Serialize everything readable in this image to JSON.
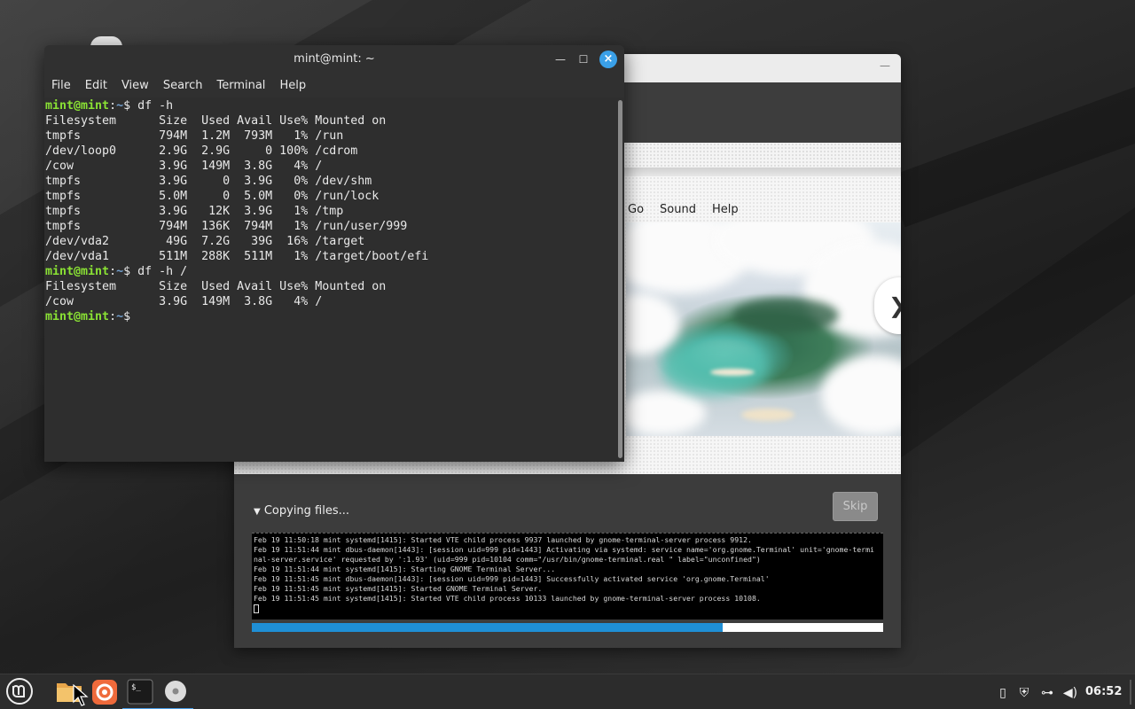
{
  "terminal": {
    "title": "mint@mint: ~",
    "menu": [
      "File",
      "Edit",
      "View",
      "Search",
      "Terminal",
      "Help"
    ],
    "lines": [
      {
        "type": "prompt",
        "user": "mint@mint",
        "path": "~",
        "cmd": "df -h"
      },
      {
        "type": "out",
        "text": "Filesystem      Size  Used Avail Use% Mounted on"
      },
      {
        "type": "out",
        "text": "tmpfs           794M  1.2M  793M   1% /run"
      },
      {
        "type": "out",
        "text": "/dev/loop0      2.9G  2.9G     0 100% /cdrom"
      },
      {
        "type": "out",
        "text": "/cow            3.9G  149M  3.8G   4% /"
      },
      {
        "type": "out",
        "text": "tmpfs           3.9G     0  3.9G   0% /dev/shm"
      },
      {
        "type": "out",
        "text": "tmpfs           5.0M     0  5.0M   0% /run/lock"
      },
      {
        "type": "out",
        "text": "tmpfs           3.9G   12K  3.9G   1% /tmp"
      },
      {
        "type": "out",
        "text": "tmpfs           794M  136K  794M   1% /run/user/999"
      },
      {
        "type": "out",
        "text": "/dev/vda2        49G  7.2G   39G  16% /target"
      },
      {
        "type": "out",
        "text": "/dev/vda1       511M  288K  511M   1% /target/boot/efi"
      },
      {
        "type": "prompt",
        "user": "mint@mint",
        "path": "~",
        "cmd": "df -h /"
      },
      {
        "type": "out",
        "text": "Filesystem      Size  Used Avail Use% Mounted on"
      },
      {
        "type": "out",
        "text": "/cow            3.9G  149M  3.8G   4% /"
      },
      {
        "type": "prompt",
        "user": "mint@mint",
        "path": "~",
        "cmd": ""
      }
    ]
  },
  "installer": {
    "slide_menu": [
      "Go",
      "Sound",
      "Help"
    ],
    "next_glyph": "❯",
    "status_label": "Copying files...",
    "skip_label": "Skip",
    "progress": 0.746,
    "log_lines": [
      "Feb 19 11:50:18 mint systemd[1415]: Started VTE child process 9937 launched by gnome-terminal-server process 9912.",
      "Feb 19 11:51:44 mint dbus-daemon[1443]: [session uid=999 pid=1443] Activating via systemd: service name='org.gnome.Terminal' unit='gnome-termi",
      "nal-server.service' requested by ':1.93' (uid=999 pid=10104 comm=\"/usr/bin/gnome-terminal.real \" label=\"unconfined\")",
      "Feb 19 11:51:44 mint systemd[1415]: Starting GNOME Terminal Server...",
      "Feb 19 11:51:45 mint dbus-daemon[1443]: [session uid=999 pid=1443] Successfully activated service 'org.gnome.Terminal'",
      "Feb 19 11:51:45 mint systemd[1415]: Started GNOME Terminal Server.",
      "Feb 19 11:51:45 mint systemd[1415]: Started VTE child process 10133 launched by gnome-terminal-server process 10108."
    ]
  },
  "taskbar": {
    "items": [
      {
        "name": "menu-icon"
      },
      {
        "name": "files-folder-icon"
      },
      {
        "name": "firefox-icon"
      },
      {
        "name": "terminal-icon"
      },
      {
        "name": "installer-disc-icon"
      }
    ],
    "clock": "06:52"
  },
  "colors": {
    "accent": "#1f8fd6",
    "prompt_user": "#8ae234",
    "prompt_path": "#729fcf",
    "close_button": "#3aa0e8"
  }
}
